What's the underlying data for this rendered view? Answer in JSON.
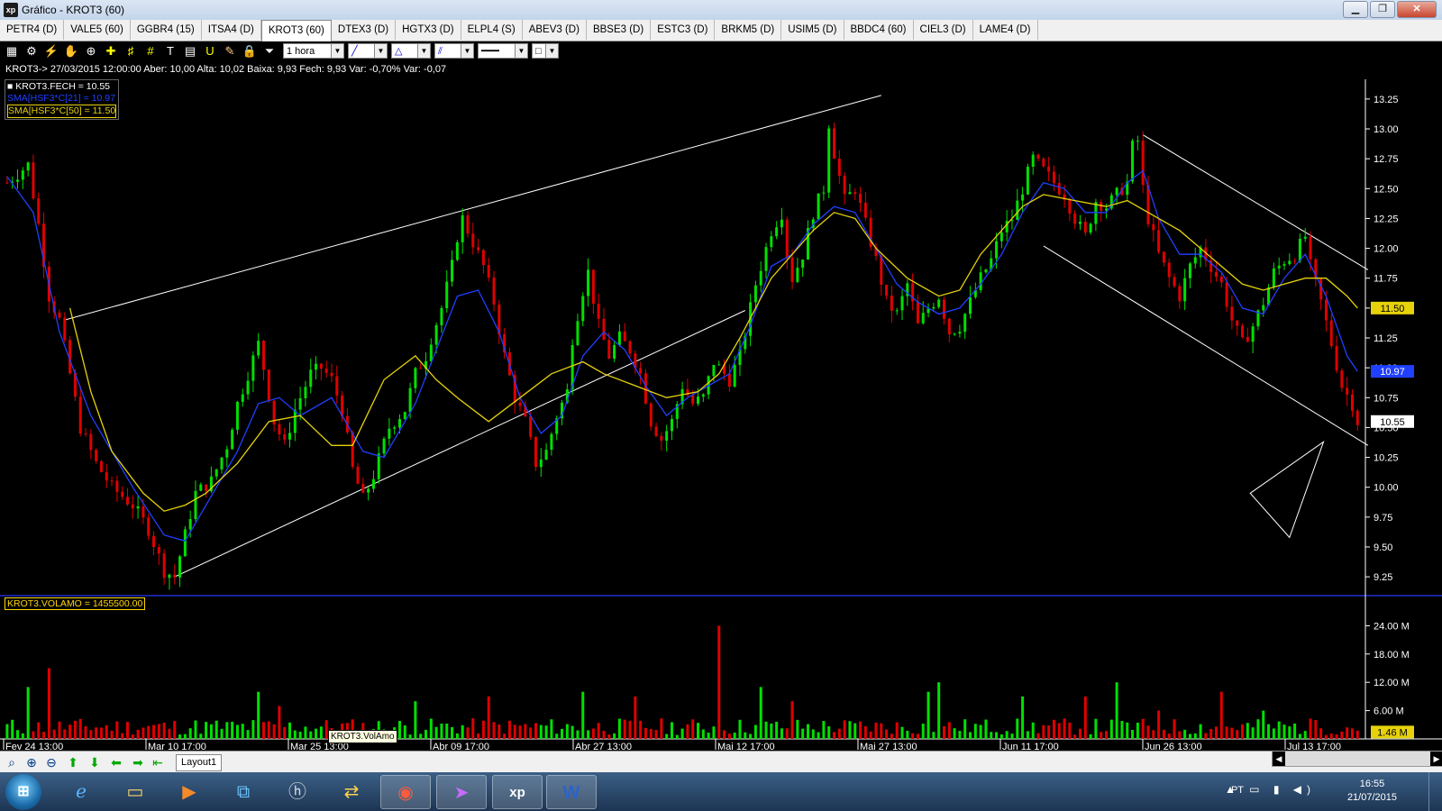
{
  "window": {
    "title": "Gráfico - KROT3 (60)",
    "app_icon": "xp",
    "min": "▁",
    "max": "❐",
    "close": "✕"
  },
  "tabs": [
    "PETR4 (D)",
    "VALE5 (60)",
    "GGBR4 (15)",
    "ITSA4 (D)",
    "KROT3 (60)",
    "DTEX3 (D)",
    "HGTX3 (D)",
    "ELPL4 (S)",
    "ABEV3 (D)",
    "BBSE3 (D)",
    "ESTC3 (D)",
    "BRKM5 (D)",
    "USIM5 (D)",
    "BBDC4 (60)",
    "CIEL3 (D)",
    "LAME4 (D)"
  ],
  "active_tab": "KROT3 (60)",
  "toolbar": {
    "period": "1 hora"
  },
  "info_line": "KROT3-> 27/03/2015 12:00:00 Aber: 10,00 Alta: 10,02 Baixa: 9,93 Fech: 9,93 Var: -0,70% Var: -0,07",
  "legend": {
    "close": "KROT3.FECH = 10.55",
    "sma21": "SMA[HSF3*C[21] = 10.97",
    "sma50": "SMA[HSF3*C[50] = 11.50"
  },
  "volume_legend": "KROT3.VOLAMO = 1455500.00",
  "volume_tooltip": "KROT3.VolAmo",
  "colors": {
    "up": "#00e000",
    "down": "#e00000",
    "sma21": "#2040ff",
    "sma50": "#e6d20a",
    "trendline": "#ffffff",
    "separator": "#2030d0"
  },
  "chart_data": {
    "type": "candlestick",
    "symbol": "KROT3",
    "interval": "60 min",
    "price_axis_ticks": [
      "13.25",
      "13.00",
      "12.75",
      "12.50",
      "12.25",
      "12.00",
      "11.75",
      "11.50",
      "11.25",
      "11.00",
      "10.75",
      "10.50",
      "10.25",
      "10.00",
      "9.75",
      "9.50",
      "9.25"
    ],
    "ylim": [
      9.1,
      13.4
    ],
    "price_badges": [
      {
        "label": "11.50",
        "value": 11.5,
        "series": "SMA 50"
      },
      {
        "label": "10.97",
        "value": 10.97,
        "series": "SMA 21"
      },
      {
        "label": "10.55",
        "value": 10.55,
        "series": "Close"
      }
    ],
    "volume_axis_ticks": [
      "24.00 M",
      "18.00 M",
      "12.00 M",
      "6.00 M"
    ],
    "volume_ylim": [
      0,
      30
    ],
    "volume_badge": "1.46 M",
    "x_ticks": [
      "Fev 24 13:00",
      "Mar 10 17:00",
      "Mar 25 13:00",
      "Abr 09 17:00",
      "Abr 27 13:00",
      "Mai 12 17:00",
      "Mai 27 13:00",
      "Jun 11 17:00",
      "Jun 26 13:00",
      "Jul 13 17:00"
    ],
    "price_path": [
      [
        0,
        12.55
      ],
      [
        4,
        12.7
      ],
      [
        6,
        12.2
      ],
      [
        8,
        11.6
      ],
      [
        10,
        11.4
      ],
      [
        12,
        10.95
      ],
      [
        14,
        10.5
      ],
      [
        17,
        10.2
      ],
      [
        20,
        10.0
      ],
      [
        24,
        9.85
      ],
      [
        27,
        9.65
      ],
      [
        30,
        9.3
      ],
      [
        32,
        9.25
      ],
      [
        34,
        9.6
      ],
      [
        36,
        9.95
      ],
      [
        39,
        10.05
      ],
      [
        42,
        10.35
      ],
      [
        44,
        10.7
      ],
      [
        46,
        10.95
      ],
      [
        48,
        11.2
      ],
      [
        49,
        11.0
      ],
      [
        51,
        10.55
      ],
      [
        53,
        10.35
      ],
      [
        55,
        10.65
      ],
      [
        58,
        10.95
      ],
      [
        60,
        11.0
      ],
      [
        62,
        10.9
      ],
      [
        64,
        10.65
      ],
      [
        66,
        10.15
      ],
      [
        68,
        9.9
      ],
      [
        70,
        10.1
      ],
      [
        73,
        10.5
      ],
      [
        76,
        10.65
      ],
      [
        78,
        10.95
      ],
      [
        80,
        11.1
      ],
      [
        81,
        11.25
      ],
      [
        83,
        11.5
      ],
      [
        85,
        11.85
      ],
      [
        86,
        12.1
      ],
      [
        87,
        12.25
      ],
      [
        89,
        12.05
      ],
      [
        91,
        11.85
      ],
      [
        93,
        11.55
      ],
      [
        95,
        11.1
      ],
      [
        97,
        10.75
      ],
      [
        99,
        10.55
      ],
      [
        101,
        10.2
      ],
      [
        103,
        10.3
      ],
      [
        105,
        10.6
      ],
      [
        107,
        10.8
      ],
      [
        108,
        11.25
      ],
      [
        110,
        11.65
      ],
      [
        111,
        11.8
      ],
      [
        113,
        11.35
      ],
      [
        115,
        11.1
      ],
      [
        117,
        11.25
      ],
      [
        119,
        11.15
      ],
      [
        121,
        10.95
      ],
      [
        123,
        10.55
      ],
      [
        125,
        10.4
      ],
      [
        127,
        10.55
      ],
      [
        129,
        10.85
      ],
      [
        131,
        10.7
      ],
      [
        133,
        10.75
      ],
      [
        135,
        11.05
      ],
      [
        136,
        11.0
      ],
      [
        138,
        10.9
      ],
      [
        140,
        11.1
      ],
      [
        143,
        11.7
      ],
      [
        146,
        12.15
      ],
      [
        148,
        12.3
      ],
      [
        149,
        11.95
      ],
      [
        150,
        11.75
      ],
      [
        152,
        11.95
      ],
      [
        154,
        12.3
      ],
      [
        156,
        12.5
      ],
      [
        157,
        13.05
      ],
      [
        158,
        12.8
      ],
      [
        160,
        12.4
      ],
      [
        162,
        12.5
      ],
      [
        164,
        12.2
      ],
      [
        166,
        11.9
      ],
      [
        168,
        11.55
      ],
      [
        170,
        11.45
      ],
      [
        172,
        11.7
      ],
      [
        174,
        11.35
      ],
      [
        176,
        11.5
      ],
      [
        178,
        11.6
      ],
      [
        180,
        11.3
      ],
      [
        182,
        11.35
      ],
      [
        184,
        11.55
      ],
      [
        186,
        11.75
      ],
      [
        188,
        11.9
      ],
      [
        190,
        12.15
      ],
      [
        192,
        12.25
      ],
      [
        194,
        12.5
      ],
      [
        196,
        12.75
      ],
      [
        198,
        12.65
      ],
      [
        200,
        12.55
      ],
      [
        202,
        12.45
      ],
      [
        204,
        12.25
      ],
      [
        206,
        12.1
      ],
      [
        208,
        12.4
      ],
      [
        210,
        12.35
      ],
      [
        212,
        12.45
      ],
      [
        214,
        12.55
      ],
      [
        215,
        12.85
      ],
      [
        216,
        12.9
      ],
      [
        217,
        12.5
      ],
      [
        218,
        12.25
      ],
      [
        220,
        11.95
      ],
      [
        222,
        11.75
      ],
      [
        224,
        11.6
      ],
      [
        226,
        11.85
      ],
      [
        228,
        12.0
      ],
      [
        230,
        11.85
      ],
      [
        232,
        11.7
      ],
      [
        234,
        11.4
      ],
      [
        236,
        11.2
      ],
      [
        238,
        11.35
      ],
      [
        240,
        11.55
      ],
      [
        242,
        11.8
      ],
      [
        244,
        11.9
      ],
      [
        246,
        11.95
      ],
      [
        248,
        12.1
      ],
      [
        249,
        11.85
      ],
      [
        251,
        11.55
      ],
      [
        253,
        11.2
      ],
      [
        255,
        10.85
      ],
      [
        257,
        10.7
      ],
      [
        258,
        10.55
      ]
    ],
    "sma21_path": [
      [
        0,
        12.6
      ],
      [
        5,
        12.3
      ],
      [
        10,
        11.3
      ],
      [
        16,
        10.6
      ],
      [
        24,
        10.0
      ],
      [
        30,
        9.6
      ],
      [
        34,
        9.55
      ],
      [
        38,
        9.85
      ],
      [
        44,
        10.3
      ],
      [
        48,
        10.7
      ],
      [
        52,
        10.75
      ],
      [
        56,
        10.6
      ],
      [
        62,
        10.75
      ],
      [
        68,
        10.3
      ],
      [
        72,
        10.25
      ],
      [
        78,
        10.7
      ],
      [
        82,
        11.15
      ],
      [
        86,
        11.6
      ],
      [
        90,
        11.65
      ],
      [
        94,
        11.3
      ],
      [
        98,
        10.75
      ],
      [
        102,
        10.45
      ],
      [
        106,
        10.6
      ],
      [
        110,
        11.1
      ],
      [
        114,
        11.3
      ],
      [
        118,
        11.15
      ],
      [
        122,
        10.85
      ],
      [
        126,
        10.6
      ],
      [
        130,
        10.75
      ],
      [
        134,
        10.85
      ],
      [
        138,
        10.95
      ],
      [
        142,
        11.35
      ],
      [
        146,
        11.85
      ],
      [
        150,
        11.95
      ],
      [
        154,
        12.2
      ],
      [
        158,
        12.35
      ],
      [
        162,
        12.3
      ],
      [
        166,
        12.0
      ],
      [
        170,
        11.7
      ],
      [
        174,
        11.55
      ],
      [
        178,
        11.45
      ],
      [
        182,
        11.5
      ],
      [
        186,
        11.7
      ],
      [
        190,
        11.95
      ],
      [
        194,
        12.3
      ],
      [
        198,
        12.55
      ],
      [
        202,
        12.5
      ],
      [
        206,
        12.3
      ],
      [
        210,
        12.3
      ],
      [
        214,
        12.55
      ],
      [
        217,
        12.65
      ],
      [
        220,
        12.25
      ],
      [
        224,
        11.95
      ],
      [
        228,
        11.95
      ],
      [
        232,
        11.8
      ],
      [
        236,
        11.5
      ],
      [
        240,
        11.45
      ],
      [
        244,
        11.75
      ],
      [
        248,
        11.95
      ],
      [
        252,
        11.6
      ],
      [
        256,
        11.1
      ],
      [
        258,
        10.97
      ]
    ],
    "sma50_path": [
      [
        12,
        11.5
      ],
      [
        16,
        10.8
      ],
      [
        20,
        10.3
      ],
      [
        26,
        9.95
      ],
      [
        30,
        9.8
      ],
      [
        34,
        9.85
      ],
      [
        38,
        9.95
      ],
      [
        44,
        10.2
      ],
      [
        50,
        10.55
      ],
      [
        56,
        10.6
      ],
      [
        62,
        10.35
      ],
      [
        66,
        10.35
      ],
      [
        72,
        10.9
      ],
      [
        78,
        11.1
      ],
      [
        82,
        10.9
      ],
      [
        86,
        10.75
      ],
      [
        92,
        10.55
      ],
      [
        98,
        10.75
      ],
      [
        104,
        10.95
      ],
      [
        110,
        11.05
      ],
      [
        114,
        10.95
      ],
      [
        120,
        10.85
      ],
      [
        126,
        10.75
      ],
      [
        132,
        10.8
      ],
      [
        136,
        10.95
      ],
      [
        140,
        11.25
      ],
      [
        146,
        11.75
      ],
      [
        150,
        11.95
      ],
      [
        154,
        12.15
      ],
      [
        158,
        12.3
      ],
      [
        162,
        12.25
      ],
      [
        166,
        12.0
      ],
      [
        172,
        11.75
      ],
      [
        178,
        11.6
      ],
      [
        182,
        11.65
      ],
      [
        186,
        11.95
      ],
      [
        190,
        12.15
      ],
      [
        194,
        12.35
      ],
      [
        198,
        12.45
      ],
      [
        204,
        12.4
      ],
      [
        210,
        12.35
      ],
      [
        214,
        12.4
      ],
      [
        218,
        12.3
      ],
      [
        224,
        12.15
      ],
      [
        228,
        12.0
      ],
      [
        232,
        11.85
      ],
      [
        236,
        11.7
      ],
      [
        240,
        11.65
      ],
      [
        244,
        11.7
      ],
      [
        248,
        11.75
      ],
      [
        252,
        11.75
      ],
      [
        256,
        11.6
      ],
      [
        258,
        11.5
      ]
    ],
    "volume_spikes": [
      [
        4,
        11
      ],
      [
        8,
        15
      ],
      [
        48,
        10
      ],
      [
        52,
        7
      ],
      [
        78,
        8
      ],
      [
        92,
        9
      ],
      [
        110,
        10
      ],
      [
        120,
        9
      ],
      [
        136,
        24
      ],
      [
        144,
        11
      ],
      [
        150,
        8
      ],
      [
        176,
        10
      ],
      [
        178,
        12
      ],
      [
        194,
        9
      ],
      [
        206,
        9
      ],
      [
        212,
        12
      ],
      [
        220,
        6
      ],
      [
        232,
        10
      ],
      [
        240,
        6
      ],
      [
        250,
        4
      ]
    ]
  }
}
